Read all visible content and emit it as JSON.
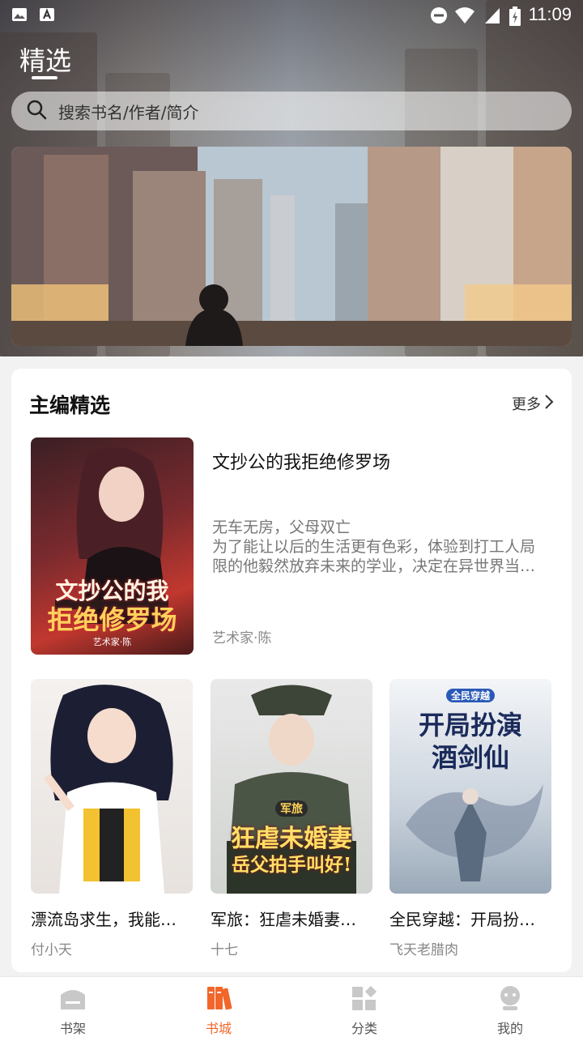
{
  "status_bar": {
    "time": "11:09",
    "left_icons": [
      "image-icon",
      "text-app-icon"
    ],
    "right_icons": [
      "do-not-disturb-icon",
      "wifi-icon",
      "signal-icon",
      "battery-charging-icon"
    ]
  },
  "header": {
    "title": "精选"
  },
  "search": {
    "placeholder": "搜索书名/作者/简介"
  },
  "banner": {
    "image": "city-street-illustration"
  },
  "section": {
    "title": "主编精选",
    "more_label": "更多"
  },
  "featured": {
    "title": "文抄公的我拒绝修罗场",
    "desc_lines": [
      "无车无房，父母双亡",
      "为了能让以后的生活更有色彩，体验到打工人局",
      "限的他毅然放弃未来的学业，决定在异世界当…"
    ],
    "author": "艺术家·陈",
    "cover_text": [
      "文抄公的我",
      "拒绝修罗场"
    ],
    "cover_tag": "艺术家·陈"
  },
  "books": [
    {
      "title": "漂流岛求生，我能…",
      "author": "付小天"
    },
    {
      "title": "军旅：狂虐未婚妻…",
      "author": "十七",
      "cover_text": [
        "军旅",
        "狂虐未婚妻",
        "岳父拍手叫好!"
      ]
    },
    {
      "title": "全民穿越：开局扮…",
      "author": "飞天老腊肉",
      "cover_text": [
        "全民穿越",
        "开局扮演",
        "酒剑仙"
      ]
    }
  ],
  "bottom_nav": {
    "items": [
      {
        "label": "书架",
        "icon": "bookshelf-icon",
        "active": false
      },
      {
        "label": "书城",
        "icon": "bookstore-icon",
        "active": true
      },
      {
        "label": "分类",
        "icon": "category-icon",
        "active": false
      },
      {
        "label": "我的",
        "icon": "profile-icon",
        "active": false
      }
    ]
  },
  "colors": {
    "accent": "#f2662a",
    "inactive_icon": "#c8c8c8"
  }
}
